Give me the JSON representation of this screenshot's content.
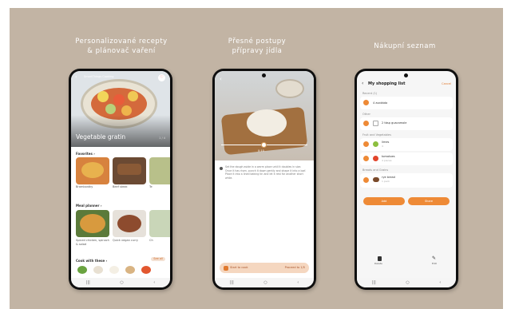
{
  "captions": {
    "left_line1": "Personalizované recepty",
    "left_line2": "& plánovač vaření",
    "middle_line1": "Přesné postupy",
    "middle_line2": "přípravy jídla",
    "right": "Nákupní seznam"
  },
  "phone1": {
    "header": "SmartThings Cooking",
    "hero_title": "Vegetable gratin",
    "hero_count": "1 / 4",
    "favorites_label": "Favorites",
    "favorites": [
      "Bramboráky",
      "Beef steak",
      "Te"
    ],
    "meal_planner_label": "Meal planner",
    "meals": [
      "Spiced chicken, spinach & salad",
      "Quick vegan curry",
      "Ch"
    ],
    "cook_label": "Cook with these",
    "see_all": "See all"
  },
  "phone2": {
    "timer": "0:10",
    "step_text": "Set the dough aside in a warm place until it doubles in size. Once it has risen, punch it down gently and shape it into a loaf. Place it into a lined baking tin and let it rest for another short while.",
    "banner_left": "Start to cook",
    "banner_right": "Proceed to 1/5"
  },
  "phone3": {
    "title": "My shopping list",
    "cancel": "Cancel",
    "section_recent": "Recent (1)",
    "item1": "4 avokáda",
    "section_other": "Other",
    "item2": "2 tbsp guacamole",
    "section_fruit": "Fruit and Vegetables",
    "item3": "limes",
    "item3_sub": "4",
    "item4": "tomatoes",
    "item4_sub": "4 pieces",
    "section_grains": "Breads and Grains",
    "item5": "rye bread",
    "item5_sub": "1 pack",
    "btn_left": "Add",
    "btn_right": "Share",
    "nav_left": "Delete",
    "nav_right": "Edit"
  }
}
